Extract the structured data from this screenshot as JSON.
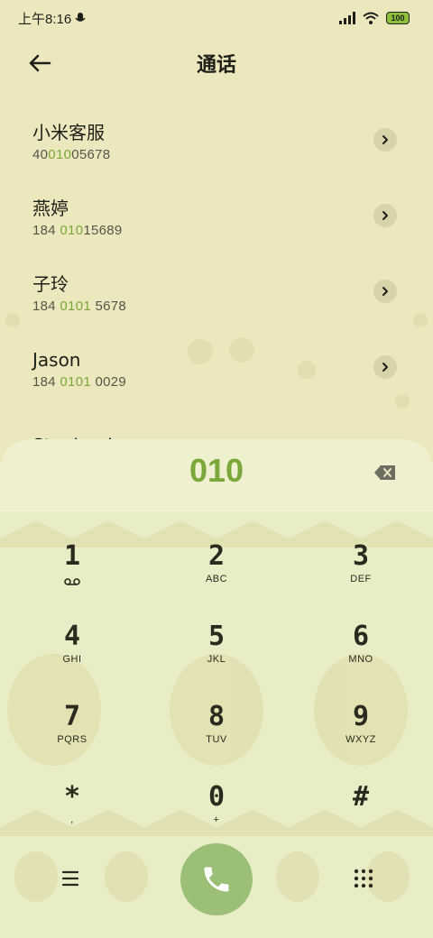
{
  "status_bar": {
    "time": "上午8:16",
    "battery": "100"
  },
  "header": {
    "title": "通话"
  },
  "contacts": [
    {
      "name": "小米客服",
      "number_pre": "40",
      "number_hl": "010",
      "number_post": "05678"
    },
    {
      "name": "燕婷",
      "number_pre": "184 ",
      "number_hl": "010",
      "number_post": "15689"
    },
    {
      "name": "子玲",
      "number_pre": "184 ",
      "number_hl": "0101",
      "number_post": " 5678"
    },
    {
      "name": "Jason",
      "number_pre": "184 ",
      "number_hl": "0101",
      "number_post": " 0029"
    },
    {
      "name": "Stephanie",
      "number_pre": "",
      "number_hl": "",
      "number_post": ""
    }
  ],
  "dialer": {
    "entered_number": "010",
    "keys": [
      {
        "digit": "1",
        "letters": "voicemail"
      },
      {
        "digit": "2",
        "letters": "ABC"
      },
      {
        "digit": "3",
        "letters": "DEF"
      },
      {
        "digit": "4",
        "letters": "GHI"
      },
      {
        "digit": "5",
        "letters": "JKL"
      },
      {
        "digit": "6",
        "letters": "MNO"
      },
      {
        "digit": "7",
        "letters": "PQRS"
      },
      {
        "digit": "8",
        "letters": "TUV"
      },
      {
        "digit": "9",
        "letters": "WXYZ"
      },
      {
        "digit": "*",
        "letters": ","
      },
      {
        "digit": "0",
        "letters": "+"
      },
      {
        "digit": "#",
        "letters": ""
      }
    ]
  },
  "colors": {
    "accent": "#7aa83a",
    "call_button": "#9cbf78",
    "background": "#ece7bd"
  }
}
